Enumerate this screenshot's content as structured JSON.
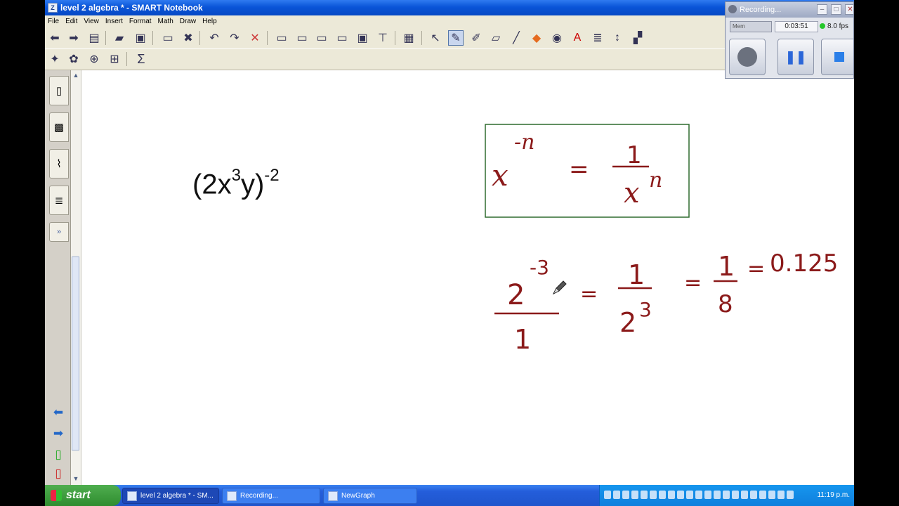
{
  "window": {
    "title": "level 2 algebra * - SMART Notebook",
    "app_icon_letter": "Z"
  },
  "menu": [
    "File",
    "Edit",
    "View",
    "Insert",
    "Format",
    "Math",
    "Draw",
    "Help"
  ],
  "canvas": {
    "typed_expression": {
      "base": "(2x",
      "exp1": "3",
      "mid": "y)",
      "exp2": "-2"
    },
    "rule_box": {
      "lhs_base": "x",
      "lhs_exp": "-n",
      "eq": "=",
      "numerator": "1",
      "den_base": "x",
      "den_exp": "n"
    },
    "worked_example": {
      "base": "2",
      "exp": "-3",
      "under": "1",
      "eq1": "=",
      "num1": "1",
      "den1_base": "2",
      "den1_exp": "3",
      "eq2": "=",
      "num2": "1",
      "den2": "8",
      "eq3": "=",
      "result": "0.125"
    }
  },
  "recorder": {
    "title": "Recording...",
    "meter_label": "Mem",
    "elapsed": "0:03:51",
    "fps": "8.0 fps"
  },
  "taskbar": {
    "start": "start",
    "tasks": [
      {
        "label": "level 2 algebra * - SM..."
      },
      {
        "label": "Recording..."
      },
      {
        "label": "NewGraph"
      }
    ],
    "clock": "11:19 p.m."
  },
  "colors": {
    "ink": "#8b1a1a",
    "box_border": "#2f6b2f",
    "titlebar": "#0a55d8"
  }
}
